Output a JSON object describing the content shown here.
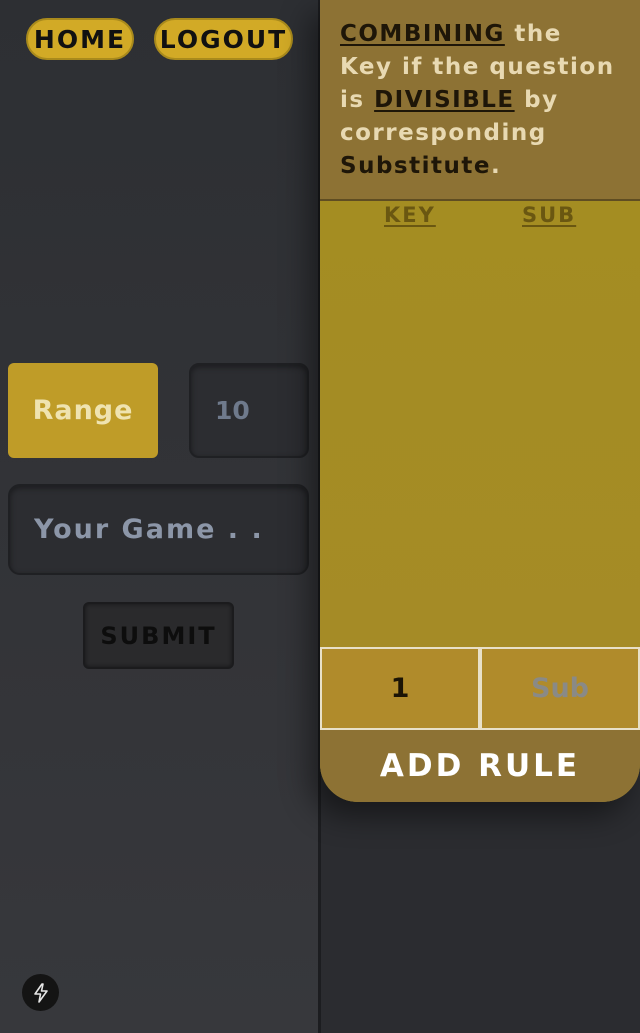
{
  "nav": {
    "home_label": "HOME",
    "logout_label": "LOGOUT"
  },
  "form": {
    "range_label": "Range",
    "range_value": "10",
    "game_placeholder": "Your Game . .",
    "submit_label": "SUBMIT"
  },
  "rules": {
    "instruction": {
      "w1": "COMBINING",
      "w2": " the Key if the question is ",
      "w3": "DIVISIBLE",
      "w4": " by corresponding ",
      "w5": "Substitute",
      "w6": "."
    },
    "col_key": "KEY",
    "col_sub": "SUB",
    "key_value": "1",
    "sub_placeholder": "Sub",
    "add_rule_label": "ADD RULE"
  },
  "icons": {
    "bolt": "lightning-bolt-icon"
  },
  "colors": {
    "accent": "#d2aa26",
    "card": "#a28b26",
    "card_header": "#8d7234",
    "background": "#2b2c30"
  }
}
